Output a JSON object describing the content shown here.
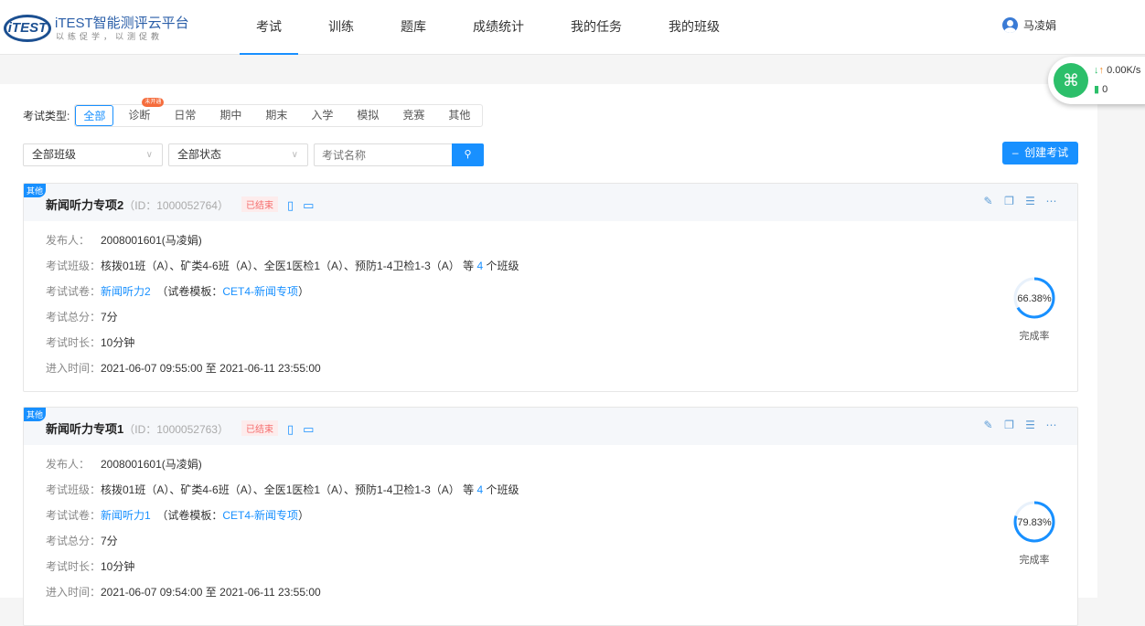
{
  "header": {
    "logo_text": "iTEST智能测评云平台",
    "logo_sub": "以练促学，以测促教",
    "logo_mark": "iTEST",
    "nav": [
      "考试",
      "训练",
      "题库",
      "成绩统计",
      "我的任务",
      "我的班级"
    ],
    "active_nav": 0,
    "user": "马凌娟"
  },
  "network": {
    "speed": "0.00K/s",
    "count": "0"
  },
  "filters": {
    "type_label": "考试类型:",
    "types": [
      "全部",
      "诊断",
      "日常",
      "期中",
      "期末",
      "入学",
      "模拟",
      "竞赛",
      "其他"
    ],
    "active_type": 0,
    "badge": "未开通",
    "class_select": "全部班级",
    "status_select": "全部状态",
    "search_placeholder": "考试名称",
    "create_button": "创建考试"
  },
  "labels": {
    "publisher": "发布人：",
    "classes": "考试班级：",
    "paper": "考试试卷：",
    "score": "考试总分：",
    "duration": "考试时长：",
    "time": "进入时间：",
    "completion": "完成率",
    "template_prefix": "（试卷模板：",
    "template_suffix": "）",
    "classes_suffix_pre": "等",
    "classes_suffix_post": "个班级",
    "to": "至"
  },
  "exams": [
    {
      "tag": "其他",
      "title": "新闻听力专项2",
      "id": "（ID：1000052764）",
      "status": "已结束",
      "publisher": "2008001601(马凌娟)",
      "classes": "核拨01班（A）、矿类4-6班（A）、全医1医检1（A）、预防1-4卫检1-3（A）",
      "class_count": "4",
      "paper": "新闻听力2",
      "template": "CET4-新闻专项",
      "score": "7分",
      "duration": "10分钟",
      "start": "2021-06-07 09:55:00",
      "end": "2021-06-11 23:55:00",
      "completion": "66.38%",
      "completion_value": 66.38
    },
    {
      "tag": "其他",
      "title": "新闻听力专项1",
      "id": "（ID：1000052763）",
      "status": "已结束",
      "publisher": "2008001601(马凌娟)",
      "classes": "核拨01班（A）、矿类4-6班（A）、全医1医检1（A）、预防1-4卫检1-3（A）",
      "class_count": "4",
      "paper": "新闻听力1",
      "template": "CET4-新闻专项",
      "score": "7分",
      "duration": "10分钟",
      "start": "2021-06-07 09:54:00",
      "end": "2021-06-11 23:55:00",
      "completion": "79.83%",
      "completion_value": 79.83
    }
  ]
}
